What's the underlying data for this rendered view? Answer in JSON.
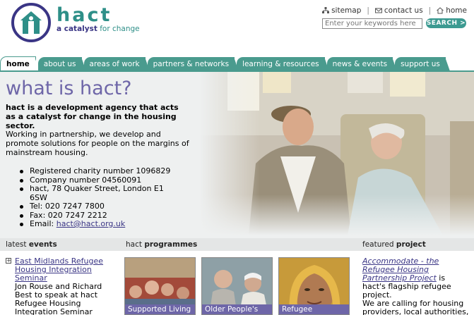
{
  "header": {
    "logo_name": "hact",
    "tagline_prefix": "a catalyst",
    "tagline_suffix": "for change",
    "util_links": [
      {
        "icon": "sitemap-icon",
        "label": "sitemap"
      },
      {
        "icon": "envelope-icon",
        "label": "contact us"
      },
      {
        "icon": "home-icon",
        "label": "home"
      }
    ],
    "search": {
      "placeholder": "Enter your keywords here",
      "button_label": "SEARCH >"
    }
  },
  "nav": {
    "tabs": [
      {
        "label": "home",
        "active": true
      },
      {
        "label": "about us"
      },
      {
        "label": "areas of work"
      },
      {
        "label": "partners & networks"
      },
      {
        "label": "learning & resources"
      },
      {
        "label": "news & events"
      },
      {
        "label": "support us"
      }
    ]
  },
  "hero": {
    "title": "what is hact?",
    "lead": "hact is a development agency that acts as a catalyst for change in the housing sector.",
    "body": "Working in partnership, we develop and promote solutions for people on the margins of mainstream housing.",
    "facts": [
      "Registered charity number 1096829",
      "Company number 04560091",
      "hact, 78 Quaker Street, London E1 6SW",
      "Tel: 020 7247 7800",
      "Fax: 020 7247 2212"
    ],
    "email_prefix": "Email: ",
    "email": "hact@hact.org.uk"
  },
  "events": {
    "heading_light": "latest",
    "heading_bold": "events",
    "items": [
      {
        "title": "East Midlands Refugee Housing Integration Seminar",
        "desc": "Jon Rouse and Richard Best to speak at hact Refugee Housing Integration Seminar"
      }
    ]
  },
  "programmes": {
    "heading_light": "hact",
    "heading_bold": "programmes",
    "items": [
      {
        "label": "Supported Living"
      },
      {
        "label": "Older People's"
      },
      {
        "label": "Refugee"
      }
    ]
  },
  "featured": {
    "heading_light": "featured",
    "heading_bold": "project",
    "link": "Accommodate - the Refugee Housing Partnership Project",
    "text1": "is hact's flagship refugee project.",
    "text2": "We are calling for housing providers, local authorities, voluntary and community"
  },
  "colors": {
    "teal": "#4a9b8e",
    "purple": "#6e66a8",
    "navy": "#3a3585"
  }
}
